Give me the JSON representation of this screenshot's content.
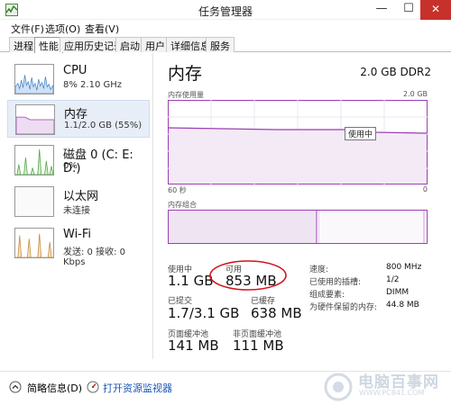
{
  "window": {
    "title": "任务管理器",
    "minimize_glyph": "—",
    "maximize_glyph": "☐",
    "close_glyph": "✕"
  },
  "menu": [
    "文件(F)",
    "选项(O)",
    "查看(V)"
  ],
  "tabs": [
    {
      "label": "进程",
      "active": false
    },
    {
      "label": "性能",
      "active": true
    },
    {
      "label": "应用历史记录",
      "active": false
    },
    {
      "label": "启动",
      "active": false
    },
    {
      "label": "用户",
      "active": false
    },
    {
      "label": "详细信息",
      "active": false
    },
    {
      "label": "服务",
      "active": false
    }
  ],
  "sidebar": {
    "items": [
      {
        "title": "CPU",
        "subtitle": "8% 2.10 GHz",
        "color": "#4a86c5",
        "selected": false
      },
      {
        "title": "内存",
        "subtitle": "1.1/2.0 GB (55%)",
        "color": "#9b3fb3",
        "selected": true
      },
      {
        "title": "磁盘 0 (C: E: D:)",
        "subtitle": "0%",
        "color": "#4aa63b",
        "selected": false
      },
      {
        "title": "以太网",
        "subtitle": "未连接",
        "color": "#a6a6a6",
        "selected": false
      },
      {
        "title": "Wi-Fi",
        "subtitle": "发送: 0 接收: 0 Kbps",
        "color": "#c98a3a",
        "selected": false
      }
    ]
  },
  "main": {
    "title": "内存",
    "spec": "2.0 GB DDR2",
    "usage_chart": {
      "label": "内存使用量",
      "max_label": "2.0 GB",
      "time_left": "60 秒",
      "time_right": "0",
      "tooltip": "使用中"
    },
    "composition_label": "内存组合",
    "stats": {
      "in_use_label": "使用中",
      "in_use_value": "1.1 GB",
      "available_label": "可用",
      "available_value": "853 MB",
      "committed_label": "已提交",
      "committed_value": "1.7/3.1 GB",
      "cached_label": "已缓存",
      "cached_value": "638 MB",
      "paged_label": "页面缓冲池",
      "paged_value": "141 MB",
      "nonpaged_label": "非页面缓冲池",
      "nonpaged_value": "111 MB"
    },
    "details": [
      {
        "key": "速度:",
        "value": "800 MHz"
      },
      {
        "key": "已使用的插槽:",
        "value": "1/2"
      },
      {
        "key": "组成要素:",
        "value": "DIMM"
      },
      {
        "key": "为硬件保留的内存:",
        "value": "44.8 MB"
      }
    ]
  },
  "footer": {
    "summary_label": "简略信息(D)",
    "resmon_label": "打开资源监视器"
  },
  "watermark": {
    "brand": "电脑百事网",
    "url": "WWW.PC841.COM"
  },
  "colors": {
    "memory_accent": "#9b3fb3",
    "annotation_circle": "#d4141b",
    "link": "#1a56b5"
  }
}
